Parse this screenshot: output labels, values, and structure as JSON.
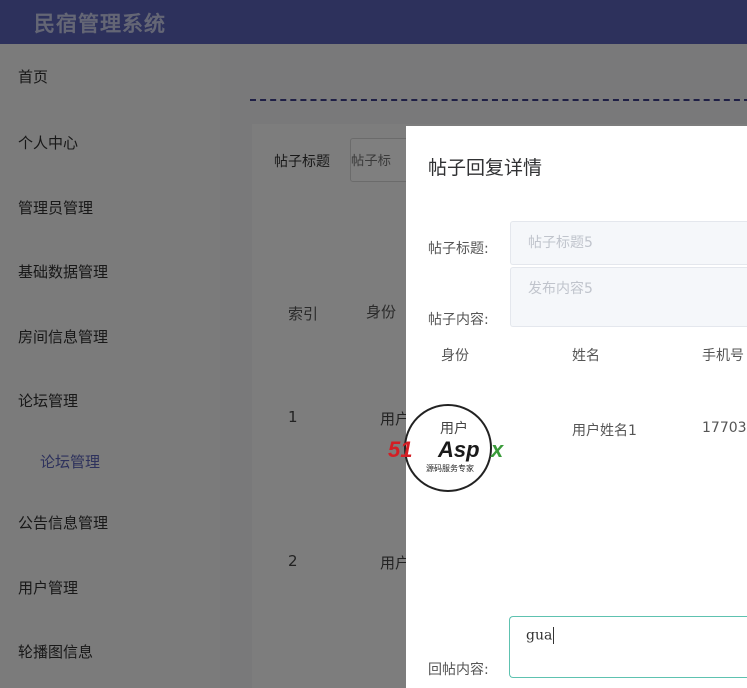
{
  "header": {
    "title": "民宿管理系统"
  },
  "sidebar": {
    "items": [
      "首页",
      "个人中心",
      "管理员管理",
      "基础数据管理",
      "房间信息管理",
      "论坛管理",
      "论坛管理",
      "公告信息管理",
      "用户管理",
      "轮播图信息"
    ]
  },
  "main": {
    "search": {
      "label": "帖子标题",
      "placeholder": "帖子标"
    },
    "table": {
      "headers": [
        "索引",
        "身份"
      ],
      "rows": [
        {
          "index": "1",
          "identity": "用户"
        },
        {
          "index": "2",
          "identity": "用户"
        }
      ]
    }
  },
  "dialog": {
    "title": "帖子回复详情",
    "post_title_label": "帖子标题:",
    "post_title_value": "帖子标题5",
    "post_content_label": "帖子内容:",
    "post_content_value": "发布内容5",
    "columns": [
      "身份",
      "姓名",
      "手机号"
    ],
    "reply": {
      "identity": "用户",
      "name": "用户姓名1",
      "phone": "17703"
    },
    "reply_label": "回帖内容:",
    "reply_value": "gua"
  },
  "watermark": {
    "brand_a": "51",
    "brand_b": "Asp",
    "brand_x": "x",
    "tagline": "源码服务专家",
    "top": "用户"
  }
}
